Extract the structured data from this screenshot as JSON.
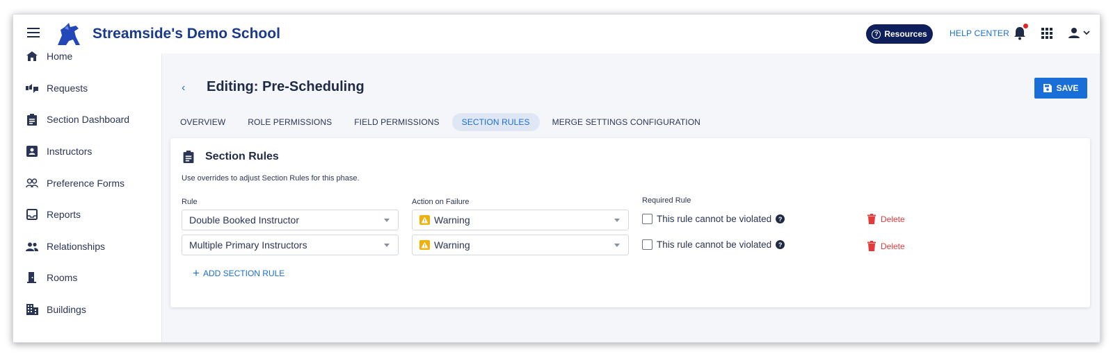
{
  "header": {
    "school_name": "Streamside's Demo School",
    "resources_label": "Resources",
    "help_center_label": "HELP CENTER",
    "accent_color": "#1a6ed8",
    "brand_navy": "#0f1f5c"
  },
  "sidebar": {
    "items": [
      {
        "label": "Home",
        "icon": "home-icon"
      },
      {
        "label": "Requests",
        "icon": "requests-icon"
      },
      {
        "label": "Section Dashboard",
        "icon": "clipboard-icon"
      },
      {
        "label": "Instructors",
        "icon": "badge-icon"
      },
      {
        "label": "Preference Forms",
        "icon": "people-outline-icon"
      },
      {
        "label": "Reports",
        "icon": "inbox-icon"
      },
      {
        "label": "Relationships",
        "icon": "group-icon"
      },
      {
        "label": "Rooms",
        "icon": "door-icon"
      },
      {
        "label": "Buildings",
        "icon": "building-icon"
      }
    ]
  },
  "page": {
    "title": "Editing: Pre-Scheduling",
    "save_label": "SAVE"
  },
  "tabs": [
    {
      "label": "OVERVIEW",
      "active": false
    },
    {
      "label": "ROLE PERMISSIONS",
      "active": false
    },
    {
      "label": "FIELD PERMISSIONS",
      "active": false
    },
    {
      "label": "SECTION RULES",
      "active": true
    },
    {
      "label": "MERGE SETTINGS CONFIGURATION",
      "active": false
    }
  ],
  "section_rules": {
    "title": "Section Rules",
    "description": "Use overrides to adjust Section Rules for this phase.",
    "columns": {
      "rule": "Rule",
      "action": "Action on Failure",
      "required": "Required Rule"
    },
    "rows": [
      {
        "rule": "Double Booked Instructor",
        "action": "Warning",
        "required_text": "This rule cannot be violated",
        "checked": false,
        "delete_label": "Delete"
      },
      {
        "rule": "Multiple Primary Instructors",
        "action": "Warning",
        "required_text": "This rule cannot be violated",
        "checked": false,
        "delete_label": "Delete"
      }
    ],
    "add_label": "ADD SECTION RULE"
  }
}
